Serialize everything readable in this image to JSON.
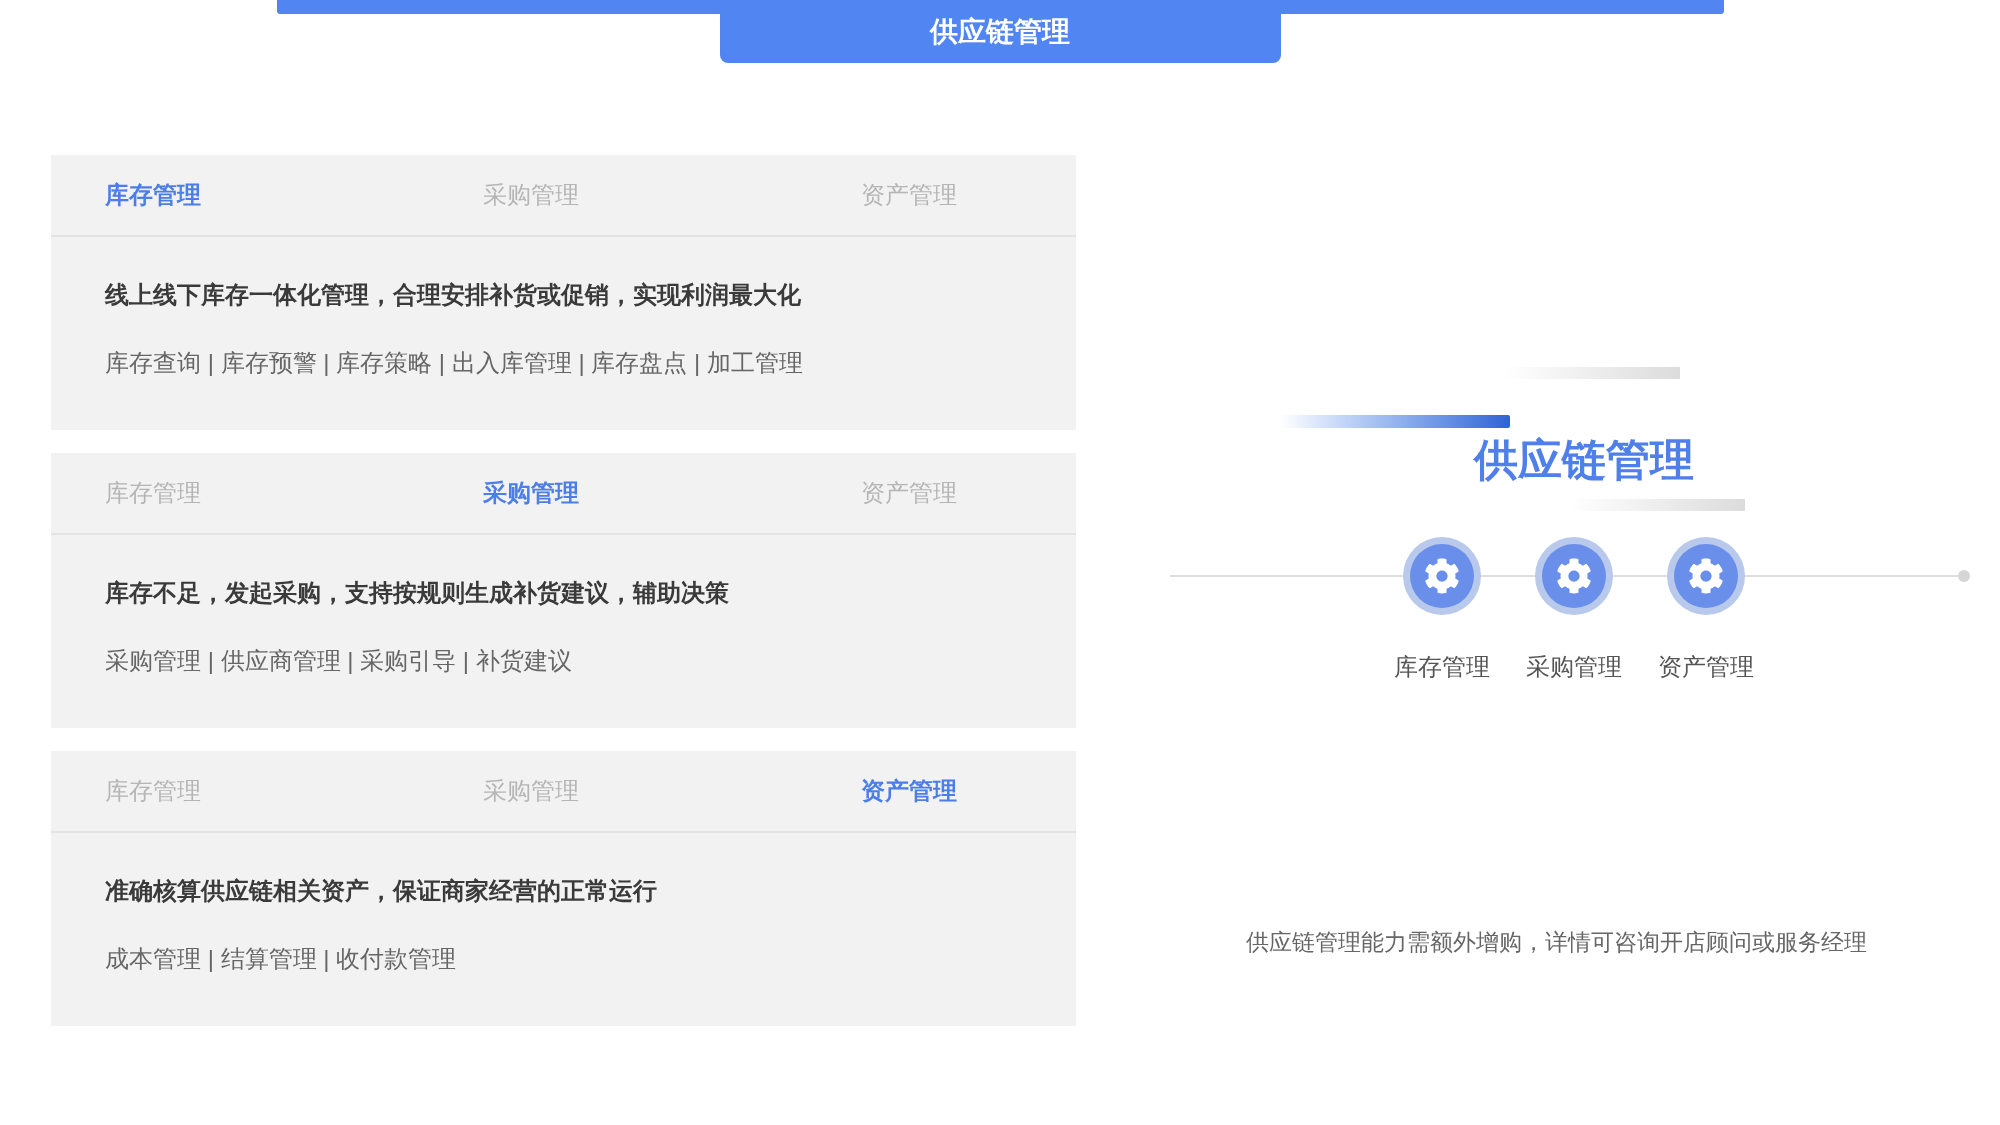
{
  "header": {
    "title": "供应链管理"
  },
  "panels": [
    {
      "tabs": [
        {
          "label": "库存管理",
          "selected": true
        },
        {
          "label": "采购管理",
          "selected": false
        },
        {
          "label": "资产管理",
          "selected": false
        }
      ],
      "headline": "线上线下库存一体化管理，合理安排补货或促销，实现利润最大化",
      "features": "库存查询 | 库存预警 | 库存策略 | 出入库管理 | 库存盘点 | 加工管理"
    },
    {
      "tabs": [
        {
          "label": "库存管理",
          "selected": false
        },
        {
          "label": "采购管理",
          "selected": true
        },
        {
          "label": "资产管理",
          "selected": false
        }
      ],
      "headline": "库存不足，发起采购，支持按规则生成补货建议，辅助决策",
      "features": "采购管理 | 供应商管理 | 采购引导 | 补货建议"
    },
    {
      "tabs": [
        {
          "label": "库存管理",
          "selected": false
        },
        {
          "label": "采购管理",
          "selected": false
        },
        {
          "label": "资产管理",
          "selected": true
        }
      ],
      "headline": "准确核算供应链相关资产，保证商家经营的正常运行",
      "features": "成本管理 | 结算管理 | 收付款管理"
    }
  ],
  "diagram": {
    "title": "供应链管理",
    "steps": [
      {
        "label": "库存管理"
      },
      {
        "label": "采购管理"
      },
      {
        "label": "资产管理"
      }
    ],
    "note": "供应链管理能力需额外增购，详情可咨询开店顾问或服务经理"
  }
}
